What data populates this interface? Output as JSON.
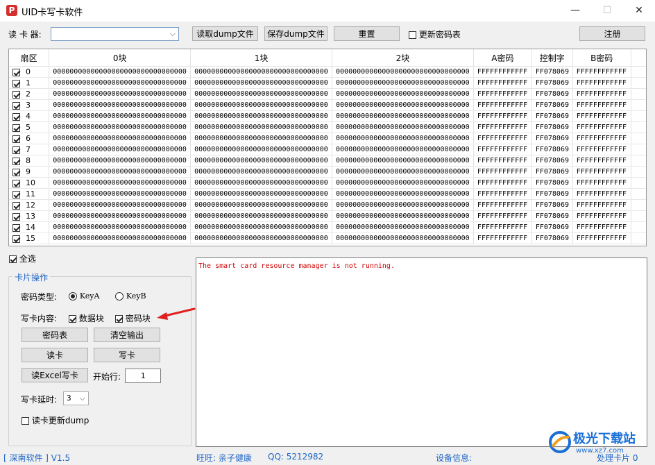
{
  "window": {
    "title": "UID卡写卡软件",
    "app_icon_glyph": "P",
    "controls": {
      "minimize": "—",
      "maximize": "☐",
      "close": "✕"
    }
  },
  "toolbar": {
    "reader_label": "读 卡 器:",
    "reader_value": "",
    "read_dump_button": "读取dump文件",
    "save_dump_button": "保存dump文件",
    "reset_button": "重置",
    "update_key_table_label": "更新密码表",
    "update_key_table_checked": false,
    "register_button": "注册"
  },
  "table": {
    "headers": [
      "扇区",
      "0块",
      "1块",
      "2块",
      "A密码",
      "控制字",
      "B密码"
    ],
    "rows": [
      {
        "sector": "0",
        "b0": "00000000000000000000000000000000",
        "b1": "00000000000000000000000000000000",
        "b2": "00000000000000000000000000000000",
        "keyA": "FFFFFFFFFFFF",
        "ctrl": "FF078069",
        "keyB": "FFFFFFFFFFFF"
      },
      {
        "sector": "1",
        "b0": "00000000000000000000000000000000",
        "b1": "00000000000000000000000000000000",
        "b2": "00000000000000000000000000000000",
        "keyA": "FFFFFFFFFFFF",
        "ctrl": "FF078069",
        "keyB": "FFFFFFFFFFFF"
      },
      {
        "sector": "2",
        "b0": "00000000000000000000000000000000",
        "b1": "00000000000000000000000000000000",
        "b2": "00000000000000000000000000000000",
        "keyA": "FFFFFFFFFFFF",
        "ctrl": "FF078069",
        "keyB": "FFFFFFFFFFFF"
      },
      {
        "sector": "3",
        "b0": "00000000000000000000000000000000",
        "b1": "00000000000000000000000000000000",
        "b2": "00000000000000000000000000000000",
        "keyA": "FFFFFFFFFFFF",
        "ctrl": "FF078069",
        "keyB": "FFFFFFFFFFFF"
      },
      {
        "sector": "4",
        "b0": "00000000000000000000000000000000",
        "b1": "00000000000000000000000000000000",
        "b2": "00000000000000000000000000000000",
        "keyA": "FFFFFFFFFFFF",
        "ctrl": "FF078069",
        "keyB": "FFFFFFFFFFFF"
      },
      {
        "sector": "5",
        "b0": "00000000000000000000000000000000",
        "b1": "00000000000000000000000000000000",
        "b2": "00000000000000000000000000000000",
        "keyA": "FFFFFFFFFFFF",
        "ctrl": "FF078069",
        "keyB": "FFFFFFFFFFFF"
      },
      {
        "sector": "6",
        "b0": "00000000000000000000000000000000",
        "b1": "00000000000000000000000000000000",
        "b2": "00000000000000000000000000000000",
        "keyA": "FFFFFFFFFFFF",
        "ctrl": "FF078069",
        "keyB": "FFFFFFFFFFFF"
      },
      {
        "sector": "7",
        "b0": "00000000000000000000000000000000",
        "b1": "00000000000000000000000000000000",
        "b2": "00000000000000000000000000000000",
        "keyA": "FFFFFFFFFFFF",
        "ctrl": "FF078069",
        "keyB": "FFFFFFFFFFFF"
      },
      {
        "sector": "8",
        "b0": "00000000000000000000000000000000",
        "b1": "00000000000000000000000000000000",
        "b2": "00000000000000000000000000000000",
        "keyA": "FFFFFFFFFFFF",
        "ctrl": "FF078069",
        "keyB": "FFFFFFFFFFFF"
      },
      {
        "sector": "9",
        "b0": "00000000000000000000000000000000",
        "b1": "00000000000000000000000000000000",
        "b2": "00000000000000000000000000000000",
        "keyA": "FFFFFFFFFFFF",
        "ctrl": "FF078069",
        "keyB": "FFFFFFFFFFFF"
      },
      {
        "sector": "10",
        "b0": "00000000000000000000000000000000",
        "b1": "00000000000000000000000000000000",
        "b2": "00000000000000000000000000000000",
        "keyA": "FFFFFFFFFFFF",
        "ctrl": "FF078069",
        "keyB": "FFFFFFFFFFFF"
      },
      {
        "sector": "11",
        "b0": "00000000000000000000000000000000",
        "b1": "00000000000000000000000000000000",
        "b2": "00000000000000000000000000000000",
        "keyA": "FFFFFFFFFFFF",
        "ctrl": "FF078069",
        "keyB": "FFFFFFFFFFFF"
      },
      {
        "sector": "12",
        "b0": "00000000000000000000000000000000",
        "b1": "00000000000000000000000000000000",
        "b2": "00000000000000000000000000000000",
        "keyA": "FFFFFFFFFFFF",
        "ctrl": "FF078069",
        "keyB": "FFFFFFFFFFFF"
      },
      {
        "sector": "13",
        "b0": "00000000000000000000000000000000",
        "b1": "00000000000000000000000000000000",
        "b2": "00000000000000000000000000000000",
        "keyA": "FFFFFFFFFFFF",
        "ctrl": "FF078069",
        "keyB": "FFFFFFFFFFFF"
      },
      {
        "sector": "14",
        "b0": "00000000000000000000000000000000",
        "b1": "00000000000000000000000000000000",
        "b2": "00000000000000000000000000000000",
        "keyA": "FFFFFFFFFFFF",
        "ctrl": "FF078069",
        "keyB": "FFFFFFFFFFFF"
      },
      {
        "sector": "15",
        "b0": "00000000000000000000000000000000",
        "b1": "00000000000000000000000000000000",
        "b2": "00000000000000000000000000000000",
        "keyA": "FFFFFFFFFFFF",
        "ctrl": "FF078069",
        "keyB": "FFFFFFFFFFFF"
      }
    ]
  },
  "select_all_label": "全选",
  "card_ops": {
    "title": "卡片操作",
    "key_type_label": "密码类型:",
    "keyA_label": "KeyA",
    "keyB_label": "KeyB",
    "key_type_selected": "KeyA",
    "write_content_label": "写卡内容:",
    "data_block_label": "数据块",
    "key_block_label": "密码块",
    "key_table_button": "密码表",
    "clear_output_button": "清空输出",
    "read_card_button": "读卡",
    "write_card_button": "写卡",
    "read_excel_button": "读Excel写卡",
    "start_row_label": "开始行:",
    "start_row_value": "1",
    "write_delay_label": "写卡延时:",
    "write_delay_value": "3",
    "read_update_dump_label": "读卡更新dump"
  },
  "output": {
    "message": "The smart card resource manager is not running."
  },
  "statusbar": {
    "company": "[ 深南软件 ]  V1.5",
    "wangwang": "旺旺:  亲子健康",
    "qq": "QQ:  5212982",
    "device_info": "设备信息:",
    "processed": "处理卡片  0"
  },
  "watermark": {
    "text": "极光下载站",
    "sub": "www.xz7.com"
  },
  "colors": {
    "accent_blue": "#1c63c6",
    "error_red": "#d00000",
    "annotation_red": "#e02020"
  }
}
